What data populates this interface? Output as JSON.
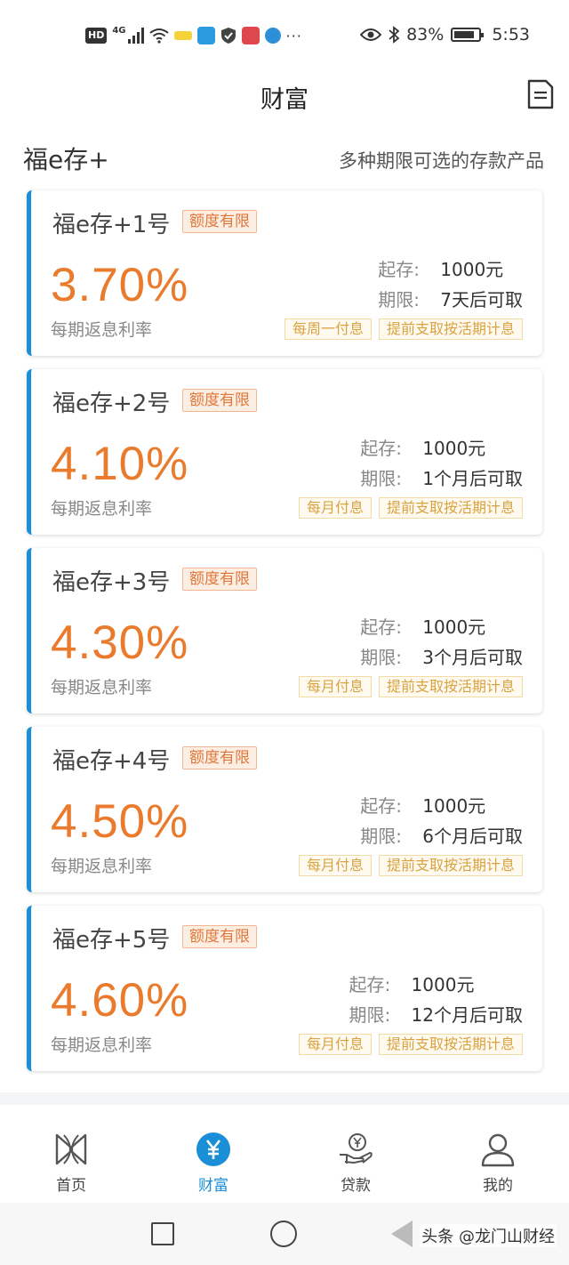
{
  "status_bar": {
    "hd": "HD",
    "network": "4G",
    "battery": "83%",
    "time": "5:53",
    "icons": [
      "signal-icon",
      "wifi-icon",
      "app-icon",
      "app-icon",
      "shield-icon",
      "app-icon",
      "app-icon",
      "more-icon",
      "eye-icon",
      "bluetooth-icon",
      "battery-icon"
    ]
  },
  "header": {
    "title": "财富",
    "doc_icon": "document-icon"
  },
  "section": {
    "title": "福e存+",
    "desc": "多种期限可选的存款产品"
  },
  "products": [
    {
      "name": "福e存+1号",
      "tag": "额度有限",
      "rate": "3.70%",
      "rate_label": "每期返息利率",
      "min_label": "起存:",
      "min_value": "1000元",
      "term_label": "期限:",
      "term_value": "7天后可取",
      "badges": [
        "每周一付息",
        "提前支取按活期计息"
      ]
    },
    {
      "name": "福e存+2号",
      "tag": "额度有限",
      "rate": "4.10%",
      "rate_label": "每期返息利率",
      "min_label": "起存:",
      "min_value": "1000元",
      "term_label": "期限:",
      "term_value": "1个月后可取",
      "badges": [
        "每月付息",
        "提前支取按活期计息"
      ]
    },
    {
      "name": "福e存+3号",
      "tag": "额度有限",
      "rate": "4.30%",
      "rate_label": "每期返息利率",
      "min_label": "起存:",
      "min_value": "1000元",
      "term_label": "期限:",
      "term_value": "3个月后可取",
      "badges": [
        "每月付息",
        "提前支取按活期计息"
      ]
    },
    {
      "name": "福e存+4号",
      "tag": "额度有限",
      "rate": "4.50%",
      "rate_label": "每期返息利率",
      "min_label": "起存:",
      "min_value": "1000元",
      "term_label": "期限:",
      "term_value": "6个月后可取",
      "badges": [
        "每月付息",
        "提前支取按活期计息"
      ]
    },
    {
      "name": "福e存+5号",
      "tag": "额度有限",
      "rate": "4.60%",
      "rate_label": "每期返息利率",
      "min_label": "起存:",
      "min_value": "1000元",
      "term_label": "期限:",
      "term_value": "12个月后可取",
      "badges": [
        "每月付息",
        "提前支取按活期计息"
      ]
    }
  ],
  "tabs": [
    {
      "label": "首页",
      "icon": "home-icon",
      "active": false
    },
    {
      "label": "财富",
      "icon": "wealth-icon",
      "active": true
    },
    {
      "label": "贷款",
      "icon": "loan-icon",
      "active": false
    },
    {
      "label": "我的",
      "icon": "profile-icon",
      "active": false
    }
  ],
  "watermark": "头条 @龙门山财经",
  "colors": {
    "accent": "#1a8fd8",
    "rate": "#ea7b2c",
    "tag": "#e0773a",
    "badge": "#d9a241"
  }
}
